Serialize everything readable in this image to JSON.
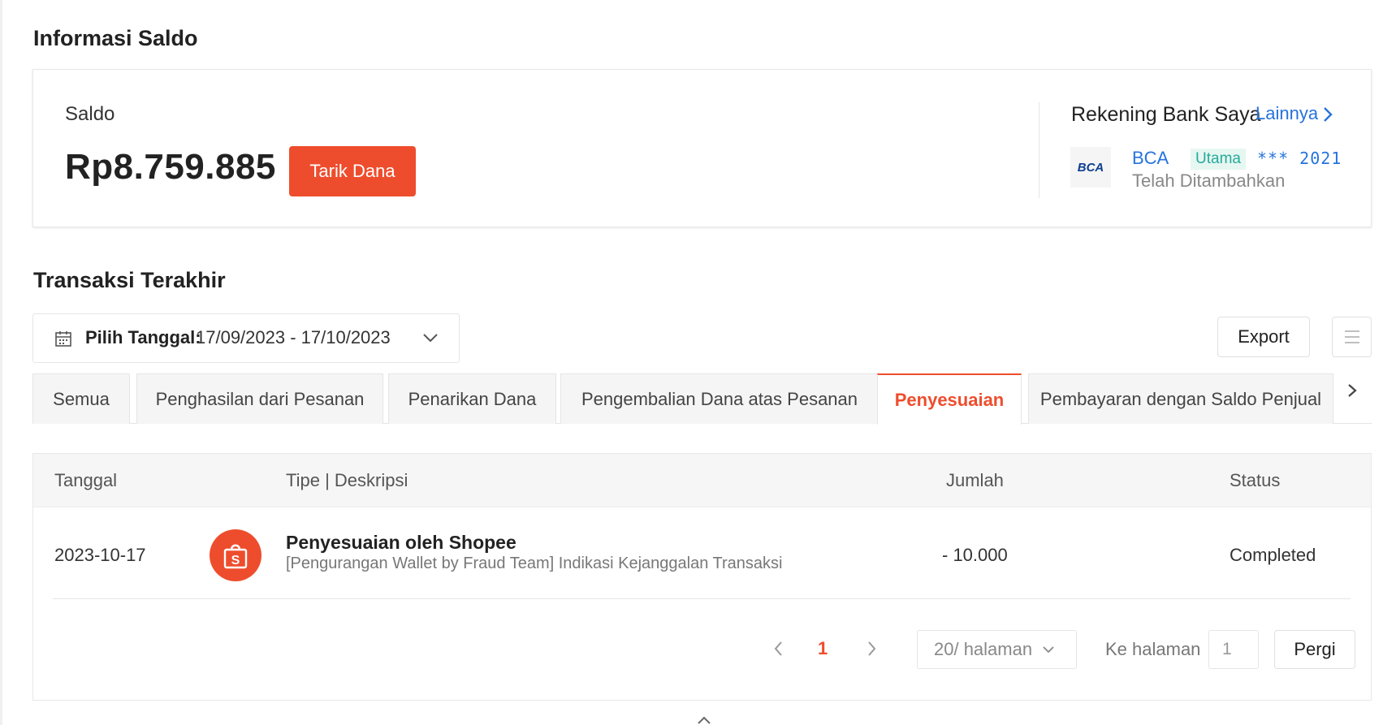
{
  "balance_section": {
    "title": "Informasi Saldo",
    "saldo_label": "Saldo",
    "saldo_amount": "Rp8.759.885",
    "withdraw_label": "Tarik Dana",
    "bank": {
      "title": "Rekening Bank Saya",
      "more_label": "Lainnya",
      "logo_text": "BCA",
      "name": "BCA",
      "badge": "Utama",
      "account": "*** 2021",
      "status": "Telah Ditambahkan"
    }
  },
  "transactions": {
    "title": "Transaksi Terakhir",
    "date_filter": {
      "label": "Pilih Tanggal:",
      "value": "17/09/2023 - 17/10/2023"
    },
    "export_label": "Export",
    "tabs": [
      {
        "label": "Semua",
        "active": false
      },
      {
        "label": "Penghasilan dari Pesanan",
        "active": false
      },
      {
        "label": "Penarikan Dana",
        "active": false
      },
      {
        "label": "Pengembalian Dana atas Pesanan",
        "active": false
      },
      {
        "label": "Penyesuaian",
        "active": true
      },
      {
        "label": "Pembayaran dengan Saldo Penjual",
        "active": false
      }
    ],
    "table": {
      "columns": [
        "Tanggal",
        "Tipe | Deskripsi",
        "Jumlah",
        "Status"
      ],
      "rows": [
        {
          "date": "2023-10-17",
          "type": "Penyesuaian oleh Shopee",
          "description": "[Pengurangan Wallet by Fraud Team] Indikasi Kejanggalan Transaksi",
          "amount": "- 10.000",
          "status": "Completed"
        }
      ]
    },
    "pagination": {
      "current_page": "1",
      "page_size": "20/ halaman",
      "goto_label": "Ke halaman",
      "goto_value": "1",
      "go_label": "Pergi"
    }
  },
  "colors": {
    "brand": "#ee4d2d",
    "link": "#2673dd",
    "badge_text": "#26aa99",
    "badge_bg": "#e6f7f2"
  },
  "icons": [
    "chevron-right-icon",
    "calendar-icon",
    "chevron-down-icon",
    "menu-lines-icon",
    "shopee-bag-icon",
    "chevron-left-icon",
    "chevron-up-icon"
  ]
}
